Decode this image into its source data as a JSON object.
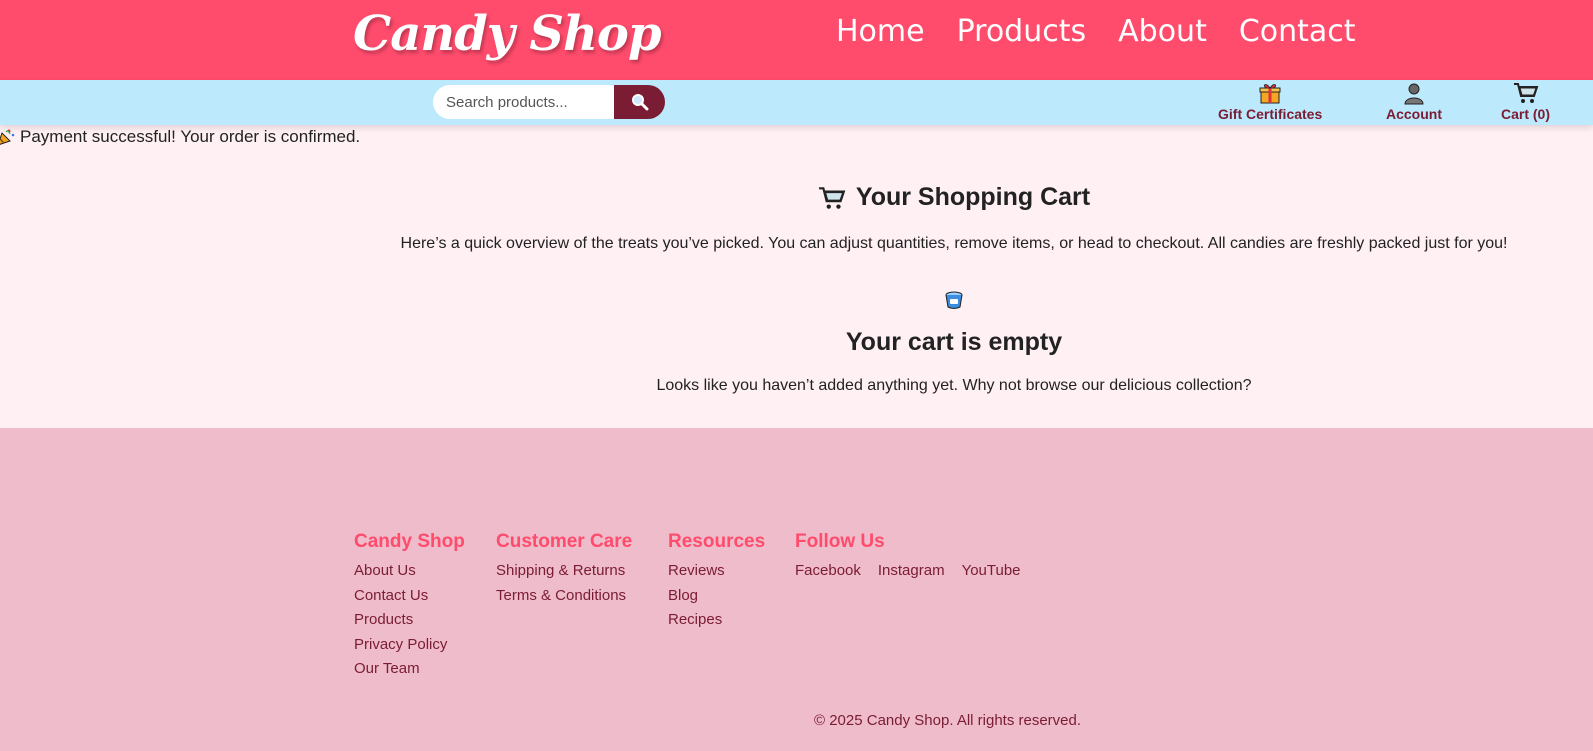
{
  "header": {
    "logo": "Candy Shop",
    "nav": [
      "Home",
      "Products",
      "About",
      "Contact"
    ]
  },
  "subbar": {
    "search_placeholder": "Search products...",
    "gift_label": "Gift Certificates",
    "account_label": "Account",
    "cart_label": "Cart (0)"
  },
  "flash": {
    "message": "Payment successful! Your order is confirmed."
  },
  "cart": {
    "title": "Your Shopping Cart",
    "intro": "Here’s a quick overview of the treats you’ve picked. You can adjust quantities, remove items, or head to checkout. All candies are freshly packed just for you!",
    "empty_title": "Your cart is empty",
    "empty_text": "Looks like you haven’t added anything yet. Why not browse our delicious collection?"
  },
  "footer": {
    "columns": [
      {
        "title": "Candy Shop",
        "links": [
          "About Us",
          "Contact Us",
          "Products",
          "Privacy Policy",
          "Our Team"
        ]
      },
      {
        "title": "Customer Care",
        "links": [
          "Shipping & Returns",
          "Terms & Conditions"
        ]
      },
      {
        "title": "Resources",
        "links": [
          "Reviews",
          "Blog",
          "Recipes"
        ]
      },
      {
        "title": "Follow Us",
        "links": [
          "Facebook",
          "Instagram",
          "YouTube"
        ]
      }
    ],
    "copyright": "© 2025 Candy Shop. All rights reserved."
  },
  "colors": {
    "header_bg": "#ff4b6c",
    "subbar_bg": "#bde9fd",
    "accent_dark": "#7a1c33",
    "page_bg": "#fff0f4",
    "footer_bg": "#efbccb"
  },
  "icons": [
    "search-icon",
    "gift-icon",
    "account-icon",
    "cart-icon",
    "party-popper-icon",
    "shopping-cart-icon",
    "empty-bucket-icon"
  ]
}
